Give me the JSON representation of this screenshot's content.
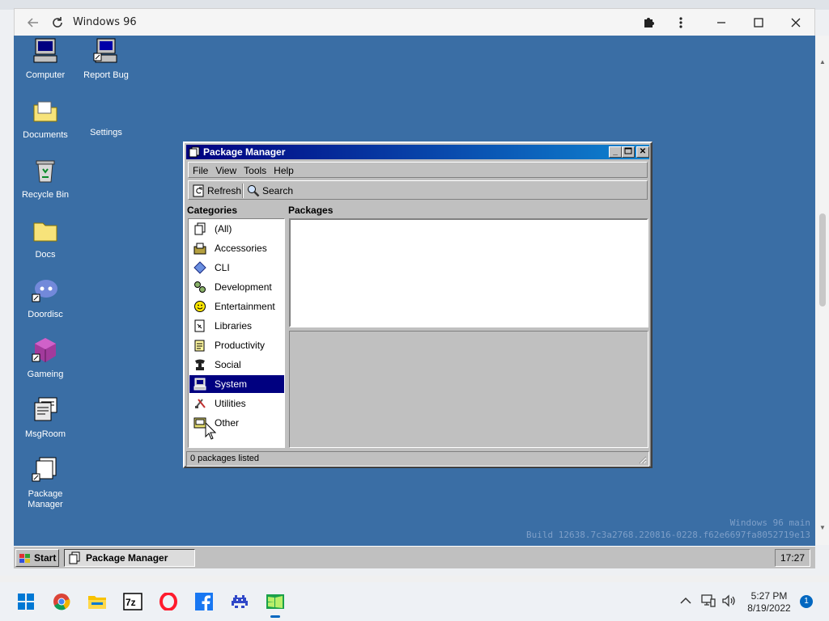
{
  "browser": {
    "title": "Windows 96",
    "back_icon": "arrow-left",
    "reload_icon": "refresh",
    "extensions_icon": "puzzle",
    "menu_icon": "kebab",
    "minimize": "minimize",
    "maximize": "maximize",
    "close": "close"
  },
  "desktop": {
    "icons": [
      {
        "label": "Computer"
      },
      {
        "label": "Report Bug"
      },
      {
        "label": "Documents"
      },
      {
        "label": "Settings"
      },
      {
        "label": "Recycle Bin"
      },
      {
        "label": "Docs"
      },
      {
        "label": "Doordisc"
      },
      {
        "label": "Gameing"
      },
      {
        "label": "MsgRoom"
      },
      {
        "label": "Package Manager"
      }
    ],
    "watermark_line1": "Windows 96 main",
    "watermark_line2": "Build 12638.7c3a2768.220816-0228.f62e6697fa8052719e13"
  },
  "pm": {
    "title": "Package Manager",
    "menu": [
      "File",
      "View",
      "Tools",
      "Help"
    ],
    "toolbar": {
      "refresh": "Refresh",
      "search": "Search"
    },
    "categories_label": "Categories",
    "packages_label": "Packages",
    "categories": [
      {
        "label": "(All)"
      },
      {
        "label": "Accessories"
      },
      {
        "label": "CLI"
      },
      {
        "label": "Development"
      },
      {
        "label": "Entertainment"
      },
      {
        "label": "Libraries"
      },
      {
        "label": "Productivity"
      },
      {
        "label": "Social"
      },
      {
        "label": "System"
      },
      {
        "label": "Utilities"
      },
      {
        "label": "Other"
      }
    ],
    "selected_category": "System",
    "status": "0 packages listed"
  },
  "w96_taskbar": {
    "start": "Start",
    "task": "Package Manager",
    "clock": "17:27"
  },
  "host_taskbar": {
    "time": "5:27 PM",
    "date": "8/19/2022",
    "notifications": "1"
  },
  "colors": {
    "desktop": "#3a6ea5",
    "title_start": "#000080",
    "title_end": "#1084d0",
    "selection": "#000080"
  }
}
